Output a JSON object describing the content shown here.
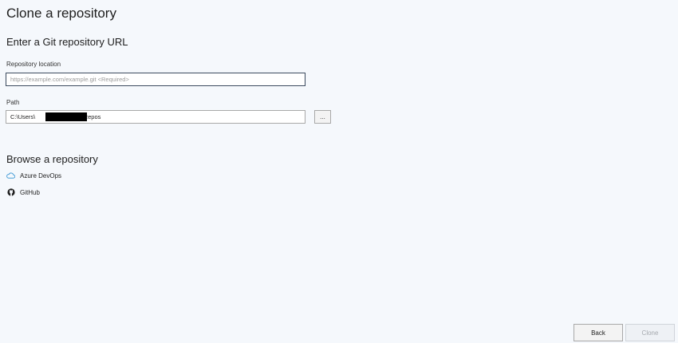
{
  "page": {
    "title": "Clone a repository"
  },
  "clone_url": {
    "heading": "Enter a Git repository URL",
    "repo_label": "Repository location",
    "repo_value": "",
    "repo_placeholder": "https://example.com/example.git <Required>",
    "path_label": "Path",
    "path_value": "C:\\Users\\                            \\Repos",
    "browse_label": "..."
  },
  "browse": {
    "heading": "Browse a repository",
    "providers": [
      {
        "label": "Azure DevOps",
        "icon": "cloud-icon"
      },
      {
        "label": "GitHub",
        "icon": "github-icon"
      }
    ]
  },
  "footer": {
    "back_label": "Back",
    "clone_label": "Clone"
  },
  "colors": {
    "background": "#f5f8fc",
    "azure_accent": "#4a9fd8",
    "focus_border": "#3b4a5e",
    "disabled_text": "#a5a9ae"
  }
}
